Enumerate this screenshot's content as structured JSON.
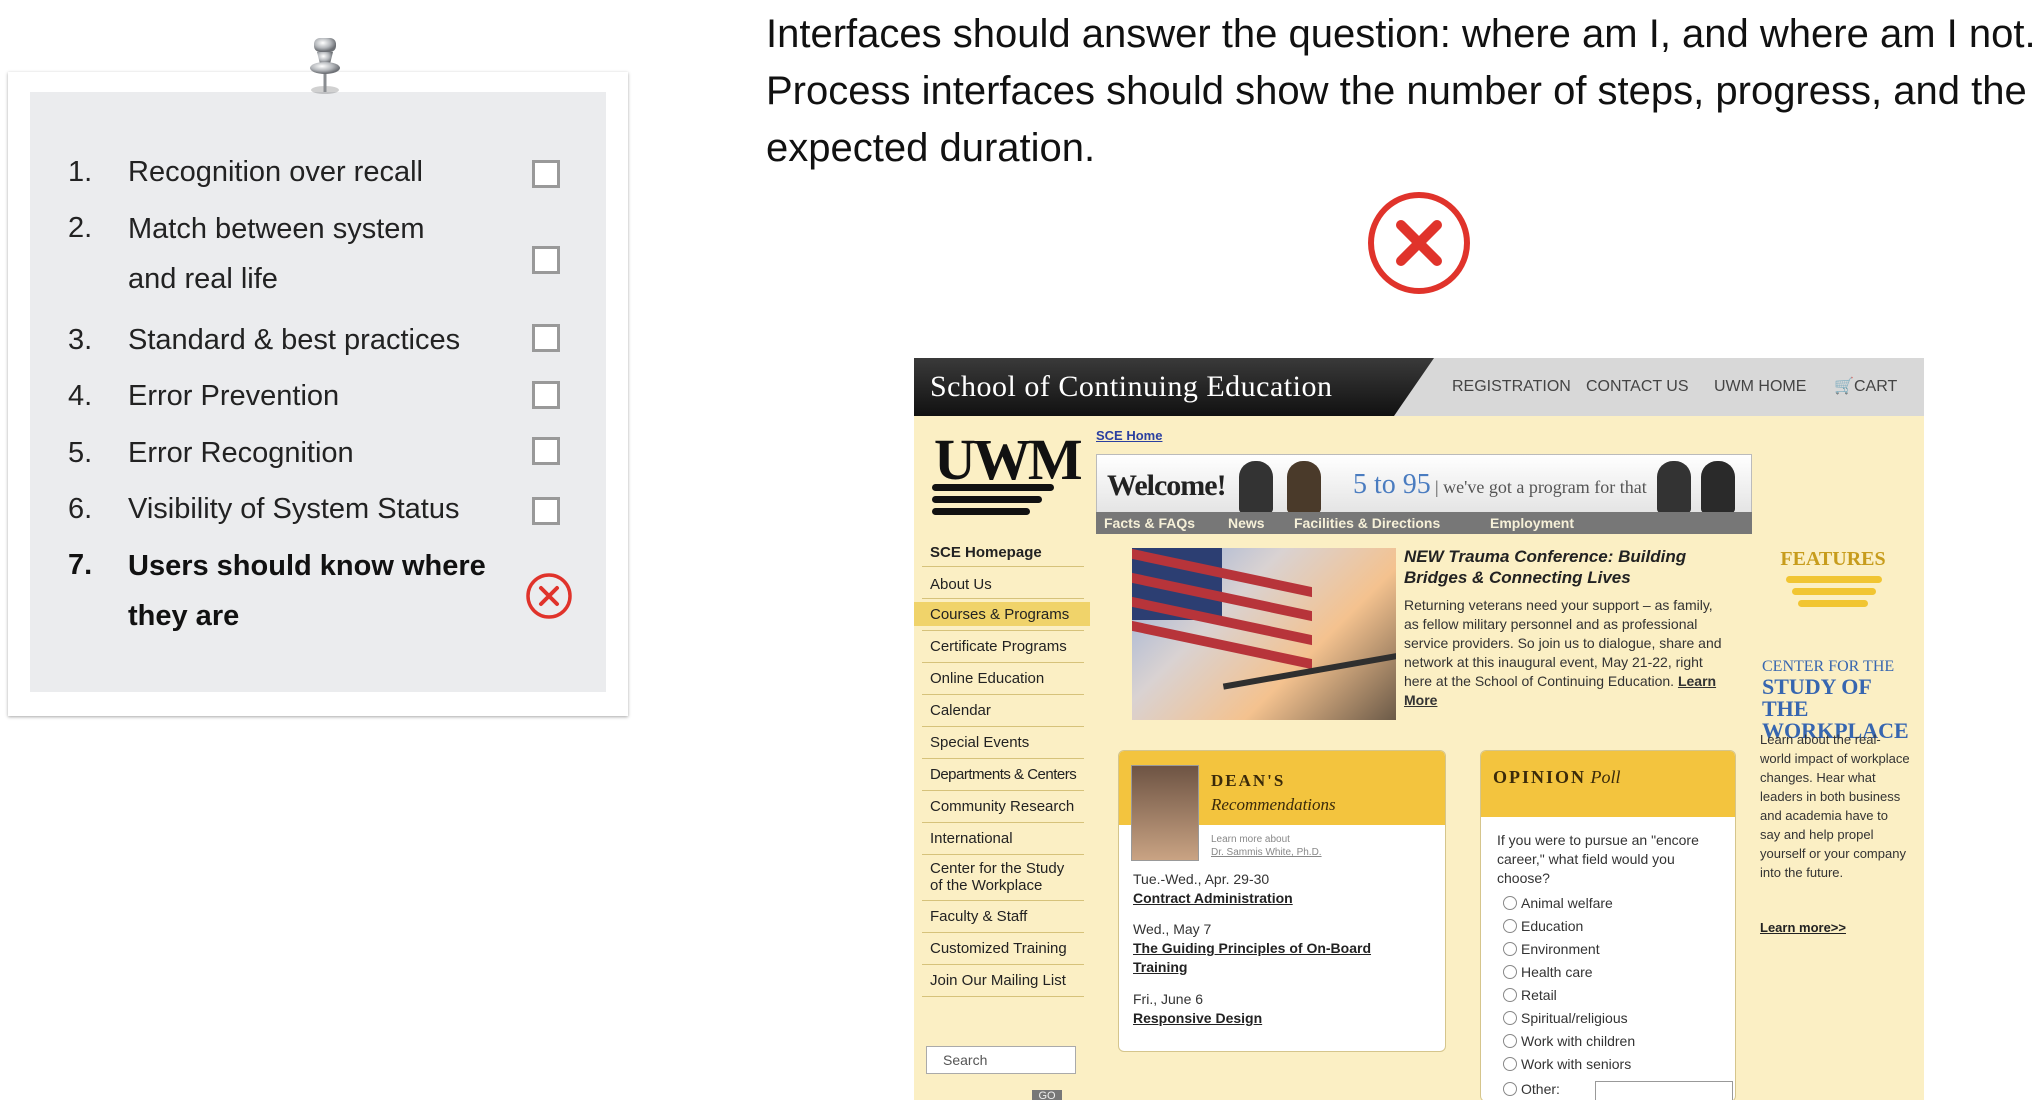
{
  "checklist": {
    "items": [
      {
        "num": "1.",
        "text": "Recognition over recall"
      },
      {
        "num": "2.",
        "text": "Match between system and real life"
      },
      {
        "num": "3.",
        "text": "Standard & best practices"
      },
      {
        "num": "4.",
        "text": "Error Prevention"
      },
      {
        "num": "5.",
        "text": "Error Recognition"
      },
      {
        "num": "6.",
        "text": "Visibility of System Status"
      },
      {
        "num": "7.",
        "text": "Users should know where they are"
      }
    ],
    "active_item_index": 6,
    "active_status_icon": "x-circle-icon"
  },
  "heading": "Interfaces should answer the question: where am I, and where am I not. Process interfaces should show the number of steps, progress, and the expected duration.",
  "verdict_icon": "x-circle-icon",
  "colors": {
    "accent_red": "#e0332b",
    "card_bg": "#ebecee",
    "site_gold": "#f3c43e",
    "site_cream": "#fbefc4"
  },
  "site": {
    "title": "School of Continuing Education",
    "top_links": [
      "REGISTRATION",
      "CONTACT US",
      "UWM HOME",
      "CART"
    ],
    "logo": "UWM",
    "breadcrumb": "SCE Home",
    "banner": {
      "welcome": "Welcome!",
      "tagline_num": "5 to 95",
      "tagline": "| we've got a program for that"
    },
    "subnav": [
      "Facts & FAQs",
      "News",
      "Facilities & Directions",
      "Employment"
    ],
    "left_nav": [
      "SCE Homepage",
      "About Us",
      "Courses & Programs",
      "Certificate Programs",
      "Online Education",
      "Calendar",
      "Special Events",
      "Departments & Centers",
      "Community Research",
      "International",
      "Center for the Study of the Workplace",
      "Faculty & Staff",
      "Customized Training",
      "Join Our Mailing List"
    ],
    "search_placeholder": "Search",
    "go_label": "GO",
    "news": {
      "title": "NEW Trauma Conference: Building Bridges & Connecting Lives",
      "body": "Returning veterans need your support – as family, as fellow military personnel and as professional service providers. So join us to dialogue, share and network at this inaugural event, May 21-22, right here at the School of Continuing Education.",
      "link": "Learn More"
    },
    "dean": {
      "title": "DEAN'S",
      "subtitle": "Recommendations",
      "learn_more": "Learn more about",
      "learn_name": "Dr. Sammis White, Ph.D.",
      "entries": [
        {
          "date": "Tue.-Wed., Apr. 29-30",
          "link": "Contract Administration"
        },
        {
          "date": "Wed., May 7",
          "link": "The Guiding Principles of On-Board Training"
        },
        {
          "date": "Fri., June 6",
          "link": "Responsive Design"
        }
      ]
    },
    "poll": {
      "title_bold": "OPINION",
      "title_italic": "Poll",
      "question": "If you were to pursue an \"encore career,\" what field would you choose?",
      "options": [
        "Animal welfare",
        "Education",
        "Environment",
        "Health care",
        "Retail",
        "Spiritual/religious",
        "Work with children",
        "Work with seniors",
        "Other:"
      ]
    },
    "features": {
      "title": "FEATURES",
      "center_line1": "CENTER FOR THE",
      "center_line2": "STUDY OF THE",
      "center_line3": "WORKPLACE",
      "body": "Learn about the real-world impact of workplace changes. Hear what leaders in both business and academia have to say and help propel yourself or your company into the future.",
      "more": "Learn more>>"
    }
  }
}
